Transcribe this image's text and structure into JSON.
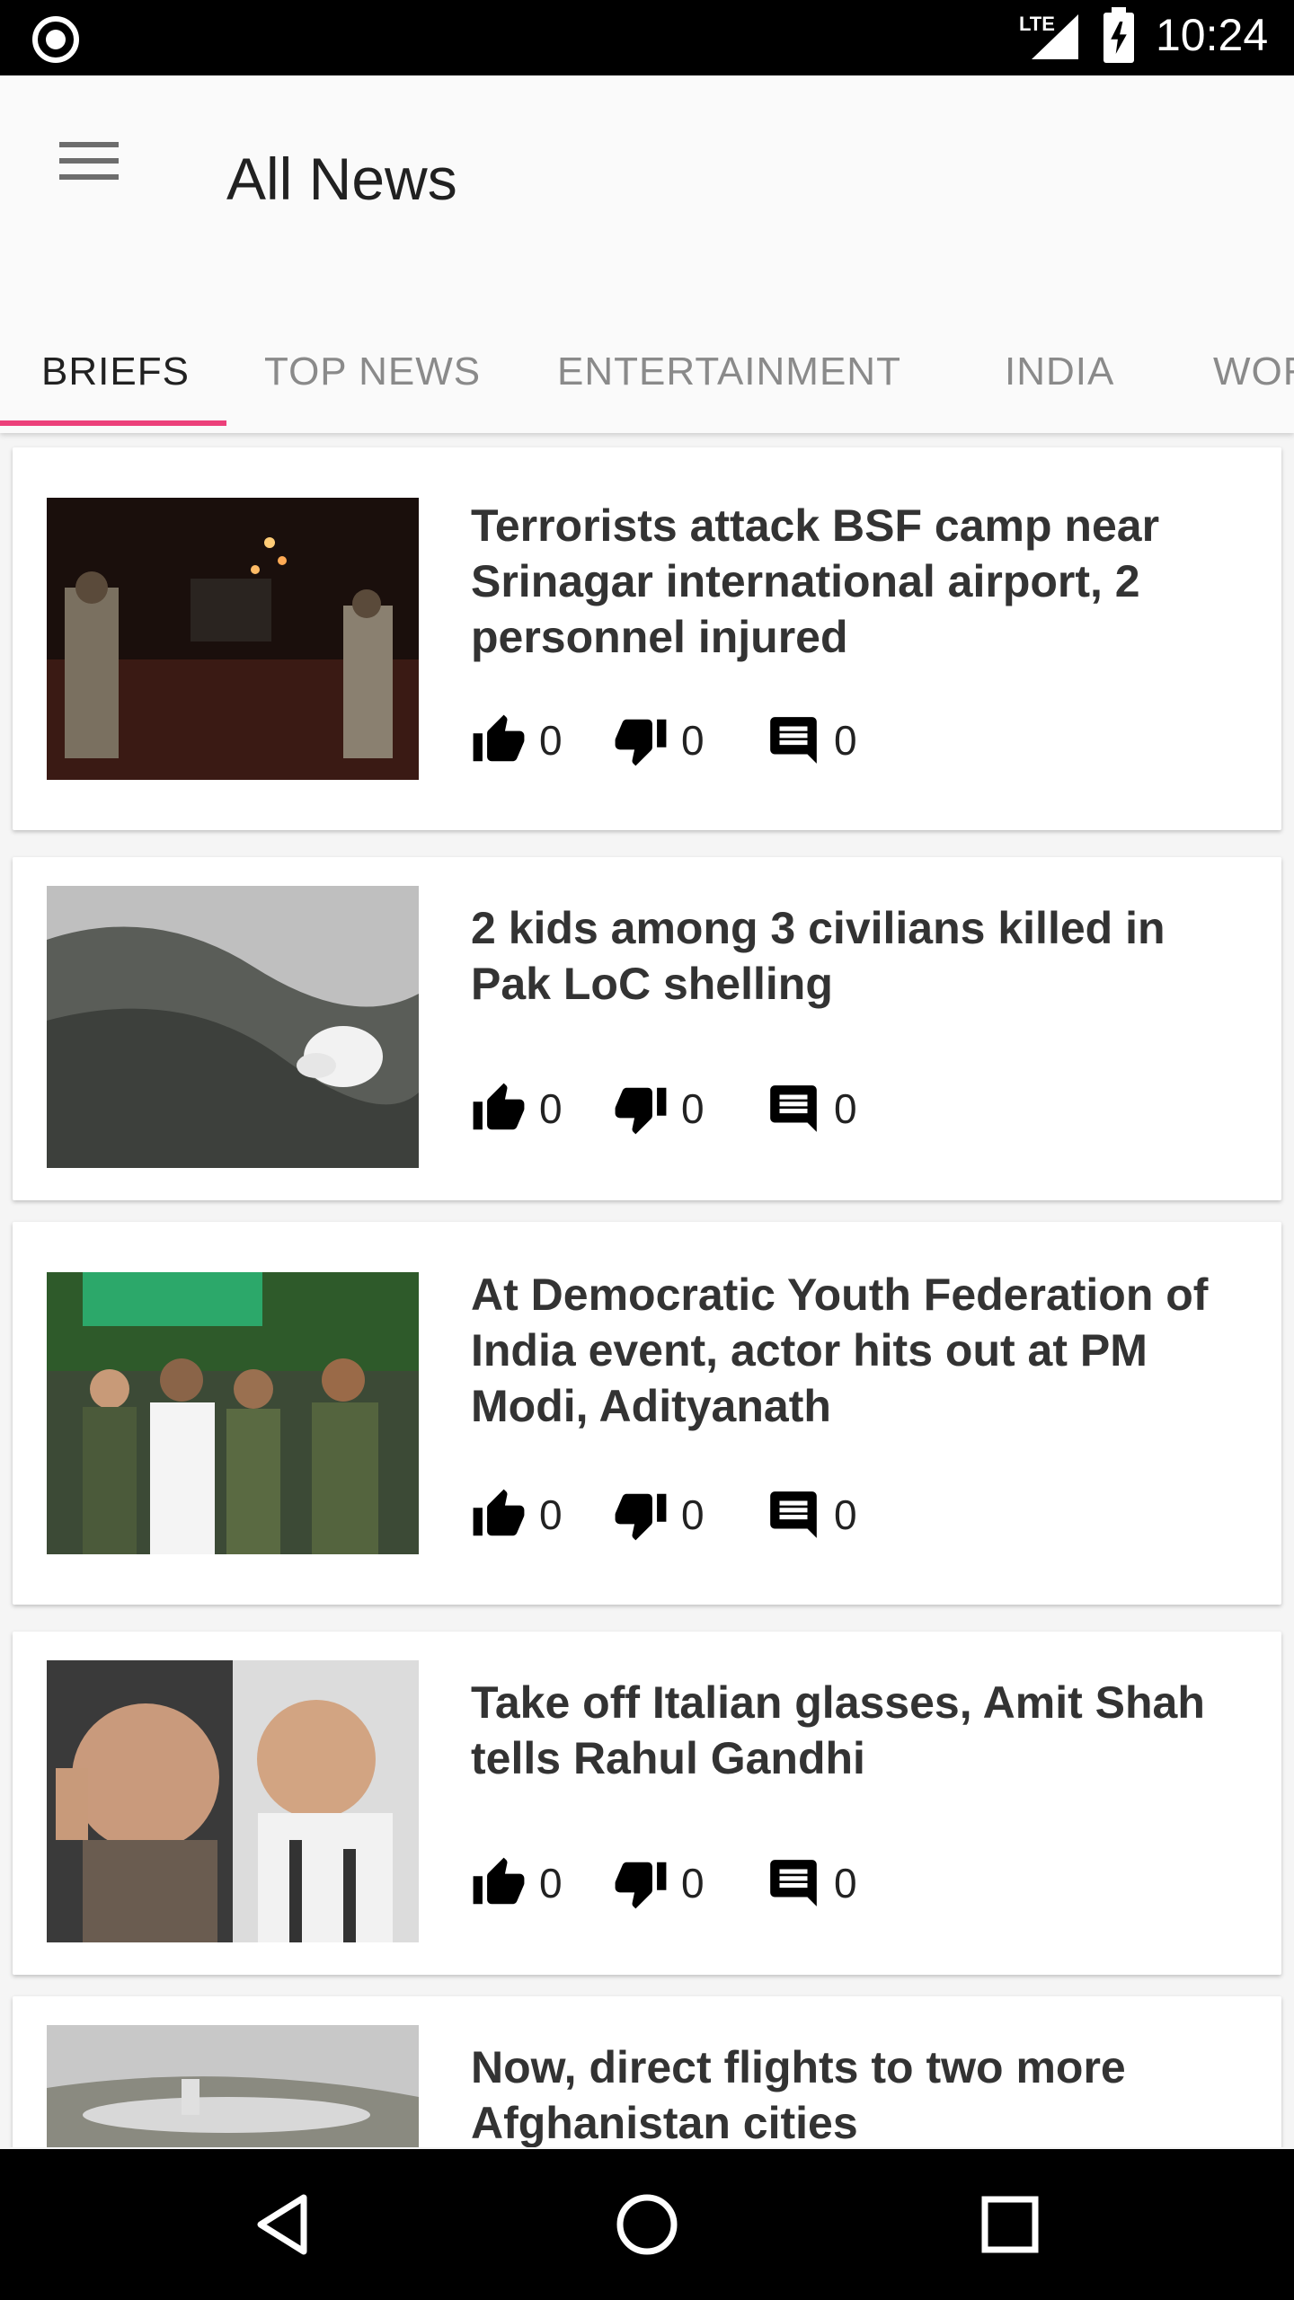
{
  "status_bar": {
    "network": "LTE",
    "time": "10:24"
  },
  "app_bar": {
    "title": "All News",
    "menu_icon": "hamburger-menu-icon"
  },
  "tabs": [
    {
      "label": "BRIEFS",
      "active": true
    },
    {
      "label": "TOP NEWS",
      "active": false
    },
    {
      "label": "ENTERTAINMENT",
      "active": false
    },
    {
      "label": "INDIA",
      "active": false
    },
    {
      "label": "WOR",
      "active": false
    }
  ],
  "accent_color": "#ec407a",
  "articles": [
    {
      "headline": "Terrorists attack BSF camp near Srinagar international airport, 2 personnel injured",
      "likes": "0",
      "dislikes": "0",
      "comments": "0"
    },
    {
      "headline": "2 kids among 3 civilians killed in Pak LoC shelling",
      "likes": "0",
      "dislikes": "0",
      "comments": "0"
    },
    {
      "headline": "At Democratic Youth Federation of India event, actor hits out at PM Modi, Adityanath",
      "likes": "0",
      "dislikes": "0",
      "comments": "0"
    },
    {
      "headline": "Take off Italian glasses, Amit Shah tells Rahul Gandhi",
      "likes": "0",
      "dislikes": "0",
      "comments": "0"
    },
    {
      "headline": "Now, direct flights to two more Afghanistan cities"
    }
  ],
  "nav_bar": {
    "back_icon": "back-triangle-icon",
    "home_icon": "home-circle-icon",
    "recents_icon": "recents-square-icon"
  }
}
